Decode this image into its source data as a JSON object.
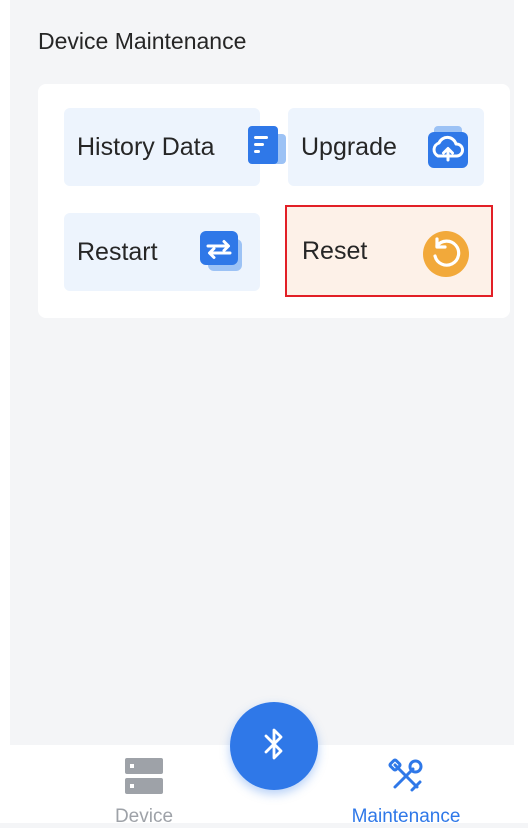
{
  "header": {
    "title": "Device Maintenance"
  },
  "tiles": [
    {
      "label": "History Data",
      "icon": "document-icon"
    },
    {
      "label": "Upgrade",
      "icon": "cloud-upload-icon"
    },
    {
      "label": "Restart",
      "icon": "swap-arrows-icon"
    },
    {
      "label": "Reset",
      "icon": "reset-icon"
    }
  ],
  "bottom_nav": {
    "tabs": [
      {
        "label": "Device",
        "icon": "server-icon",
        "active": false
      },
      {
        "label": "Maintenance",
        "icon": "tools-icon",
        "active": true
      }
    ],
    "center_button_icon": "bluetooth-icon"
  },
  "colors": {
    "accent": "#2f78e8",
    "reset_highlight_border": "#e21f26",
    "reset_icon": "#f2a93a",
    "inactive_tab": "#9ea2a8"
  }
}
